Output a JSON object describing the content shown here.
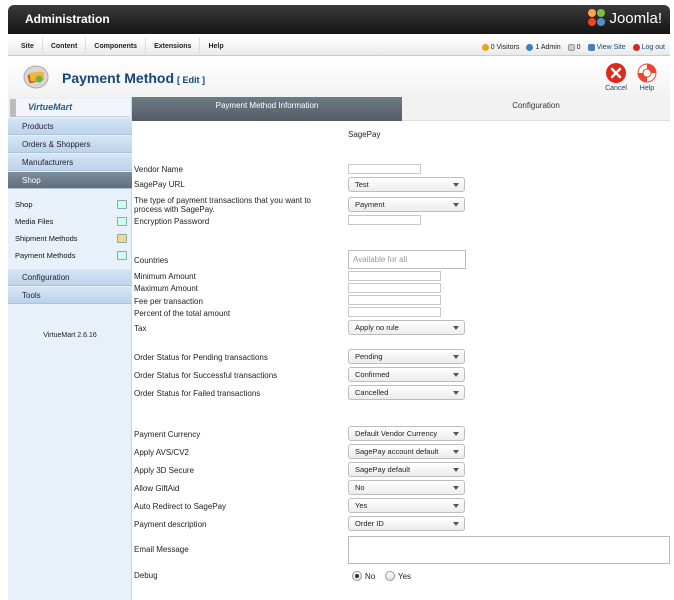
{
  "header": {
    "title": "Administration",
    "logo_text": "Joomla!"
  },
  "menu": [
    "Site",
    "Content",
    "Components",
    "Extensions",
    "Help"
  ],
  "status": {
    "visitors": "0 Visitors",
    "admin": "1 Admin",
    "messages": "0",
    "view_site": "View Site",
    "logout": "Log out"
  },
  "toolbar": {
    "page_title": "Payment Method",
    "edit_label": "[ Edit ]",
    "cancel": "Cancel",
    "help": "Help"
  },
  "sidebar": {
    "logo": "VirtueMart",
    "nav": {
      "products": "Products",
      "orders": "Orders & Shoppers",
      "manufacturers": "Manufacturers",
      "shop": "Shop",
      "configuration": "Configuration",
      "tools": "Tools"
    },
    "sub": {
      "shop": "Shop",
      "media": "Media Files",
      "shipment": "Shipment Methods",
      "payment": "Payment Methods"
    },
    "version": "VirtueMart 2.6.16"
  },
  "tabs": {
    "info": "Payment Method Information",
    "config": "Configuration"
  },
  "form": {
    "section_title": "SagePay",
    "vendor_name": "Vendor Name",
    "sagepay_url": "SagePay URL",
    "sagepay_url_value": "Test",
    "transaction_type": "The type of payment transactions that you want to process with SagePay.",
    "transaction_type_value": "Payment",
    "encryption_password": "Encryption Password",
    "countries": "Countries",
    "countries_placeholder": "Available for all",
    "minimum_amount": "Minimum Amount",
    "maximum_amount": "Maximum Amount",
    "fee_per_transaction": "Fee per transaction",
    "percent_total": "Percent of the total amount",
    "tax": "Tax",
    "tax_value": "Apply no rule",
    "status_pending": "Order Status for Pending transactions",
    "status_pending_value": "Pending",
    "status_success": "Order Status for Successful transactions",
    "status_success_value": "Confirmed",
    "status_failed": "Order Status for Failed transactions",
    "status_failed_value": "Cancelled",
    "payment_currency": "Payment Currency",
    "payment_currency_value": "Default Vendor Currency",
    "avs": "Apply AVS/CV2",
    "avs_value": "SagePay account default",
    "secure3d": "Apply 3D Secure",
    "secure3d_value": "SagePay default",
    "giftaid": "Allow GiftAid",
    "giftaid_value": "No",
    "auto_redirect": "Auto Redirect to SagePay",
    "auto_redirect_value": "Yes",
    "payment_description": "Payment description",
    "payment_description_value": "Order ID",
    "email_message": "Email Message",
    "debug": "Debug",
    "debug_no": "No",
    "debug_yes": "Yes"
  }
}
